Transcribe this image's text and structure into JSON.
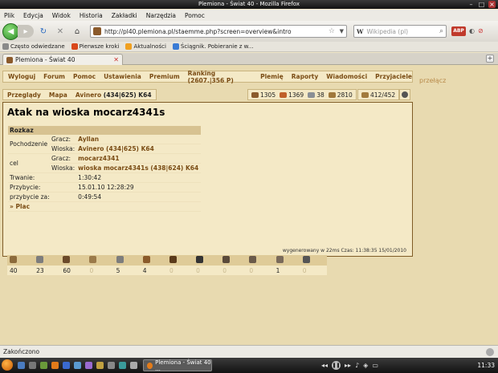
{
  "window": {
    "title": "Plemiona - Świat 40 - Mozilla Firefox"
  },
  "menubar": [
    "Plik",
    "Edycja",
    "Widok",
    "Historia",
    "Zakładki",
    "Narzędzia",
    "Pomoc"
  ],
  "navbar": {
    "url": "http://pl40.plemiona.pl/staemme.php?screen=overview&intro",
    "search_placeholder": "Wikipedia (pl)",
    "search_engine_letter": "W",
    "abp_label": "ABP"
  },
  "bookmarks": [
    {
      "label": "Często odwiedzane",
      "color": "#8a8a8a"
    },
    {
      "label": "Pierwsze kroki",
      "color": "#d9481b"
    },
    {
      "label": "Aktualności",
      "color": "#f0a020"
    },
    {
      "label": "Ściągnik. Pobieranie z w...",
      "color": "#3a7bd5"
    }
  ],
  "tab": {
    "label": "Plemiona - Świat 40"
  },
  "game_menu": {
    "items": [
      "Wyloguj",
      "Forum",
      "Pomoc",
      "Ustawienia",
      "Premium",
      "Ranking (2607.|356 P)",
      "Plemię",
      "Raporty",
      "Wiadomości",
      "Przyjaciele"
    ],
    "switch_label": "przełącz"
  },
  "breadcrumb": {
    "overview": "Przeglądy",
    "map": "Mapa",
    "village": "Avinero",
    "coords": "(434|625) K64"
  },
  "resources": {
    "wood": "1305",
    "wood_color": "#8b5a2b",
    "clay": "1369",
    "clay_color": "#c0602a",
    "iron": "38",
    "iron_color": "#8a8f95",
    "warehouse": "2810",
    "warehouse_color": "#a0783c",
    "farm": "412/452"
  },
  "command": {
    "title": "Atak na wioska mocarz4341s",
    "header": "Rozkaz",
    "origin_label": "Pochodzenie",
    "player_label": "Gracz:",
    "village_label": "Wioska:",
    "origin_player": "Ayllan",
    "origin_village": "Avinero (434|625) K64",
    "target_label": "cel",
    "target_player": "mocarz4341",
    "target_village": "wioska mocarz4341s (438|624) K64",
    "duration_label": "Trwanie:",
    "duration": "1:30:42",
    "arrival_label": "Przybycie:",
    "arrival": "15.01.10 12:28:29",
    "arrival_in_label": "przybycie za:",
    "arrival_in": "0:49:54",
    "plac_link": "» Plac"
  },
  "units": [
    {
      "icon": "spear-icon",
      "count": "40",
      "color": "#8c6b3c"
    },
    {
      "icon": "sword-icon",
      "count": "23",
      "color": "#7d7d7d"
    },
    {
      "icon": "axe-icon",
      "count": "60",
      "color": "#6b4a2a"
    },
    {
      "icon": "archer-icon",
      "count": "0",
      "color": "#9b7a4a"
    },
    {
      "icon": "scout-icon",
      "count": "5",
      "color": "#7d7d7d"
    },
    {
      "icon": "light-cavalry-icon",
      "count": "4",
      "color": "#8a5a2a"
    },
    {
      "icon": "mounted-archer-icon",
      "count": "0",
      "color": "#5a3a1a"
    },
    {
      "icon": "heavy-cavalry-icon",
      "count": "0",
      "color": "#333333"
    },
    {
      "icon": "ram-icon",
      "count": "0",
      "color": "#5a4a3a"
    },
    {
      "icon": "catapult-icon",
      "count": "0",
      "color": "#6a5a4a"
    },
    {
      "icon": "knight-icon",
      "count": "1",
      "color": "#7a6a5a"
    },
    {
      "icon": "noble-icon",
      "count": "0",
      "color": "#555555"
    }
  ],
  "footer": "wygenerowany w 22ms Czas: 11:38:35 15/01/2010",
  "statusbar": "Zakończono",
  "taskbar": {
    "task_label": "Plemiona - Świat 40 ...",
    "clock": "11:33"
  }
}
